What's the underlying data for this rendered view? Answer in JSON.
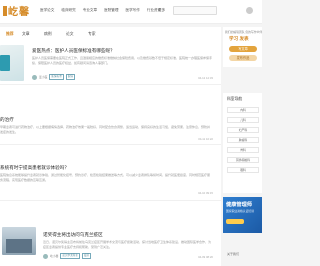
{
  "header": {
    "logo_text": "屹馨",
    "nav_items": [
      "医学论文",
      "临床研究",
      "专业文章",
      "医院管理",
      "医学写作",
      "行业资讯"
    ],
    "more_label": "更多",
    "search_placeholder": ""
  },
  "tabs": [
    {
      "label": "推荐",
      "active": true
    },
    {
      "label": "文章"
    },
    {
      "label": "病例"
    },
    {
      "label": "论文"
    },
    {
      "label": "专家"
    }
  ],
  "articles": [
    {
      "title": "爱医热点：医护人员医保标准有哪些呢？",
      "desc": "医护人员医保需要在医院正式工作，且遵循相应的缴费标准缴纳社会保险费用，以及缴费基数不低于规定标准，医院统一办理医保参保手续，保障医护人员的医疗权益，如有疑问请咨询人事部门。",
      "author": "爱小医",
      "tag": "医保标准",
      "tag2": "医保",
      "time": "04-12 12:33"
    },
    {
      "title": "的治疗",
      "desc": "早期患者可进行药物治疗，以上要根据病情选择，药物治疗效果一般较好，同时配合饮食调整，适当运动，保持良好的生活习惯，避免劳累，注意休息，预防并发症的发生。",
      "time": "04-11 10:22"
    },
    {
      "title": "系统有时宁提高患者就诊体验吗？",
      "desc": "医院信息系统能够提升患者就诊体验，通过智能化挂号、预约诊疗、检查检验结果推送等方式，可以减少患者排队等候时间，提升就医便捷度，同时规范医疗服务流程，实现医疗数据的互联互通。",
      "time": "04-10 09:15"
    },
    {
      "title": "诺奖得主将出访问乌克兰疫区",
      "desc": "近日，诺贝尔奖得主宣布将前往乌克兰疫区开展学术交流与医疗援助活动，探讨当地医疗卫生体系建设，推动国际医学合作，为疫区患者提供专业医疗支持和帮助，受到广泛关注。",
      "author": "屹小馨",
      "tag": "诺贝尔奖得主",
      "tag2": "疫区",
      "time": "04-09 08:20"
    }
  ],
  "readmore_label": "阅读全文",
  "sidebar": {
    "top_line": "我们的编辑团队 您的写作伙伴",
    "headline": "学习 发表",
    "btn1": "写文章",
    "btn2": "发布作品",
    "nav_title": "科室导航",
    "items": [
      "内科",
      "儿科",
      "妇产科",
      "肿瘤科",
      "骨科",
      "耳鼻咽喉科",
      "眼科"
    ],
    "banner_title": "健康管理师",
    "banner_sub": "国家职业资格认证培训",
    "foot": "关于我们"
  },
  "colors": {
    "accent": "#d68c2a",
    "banner": "#2f7fd1"
  }
}
